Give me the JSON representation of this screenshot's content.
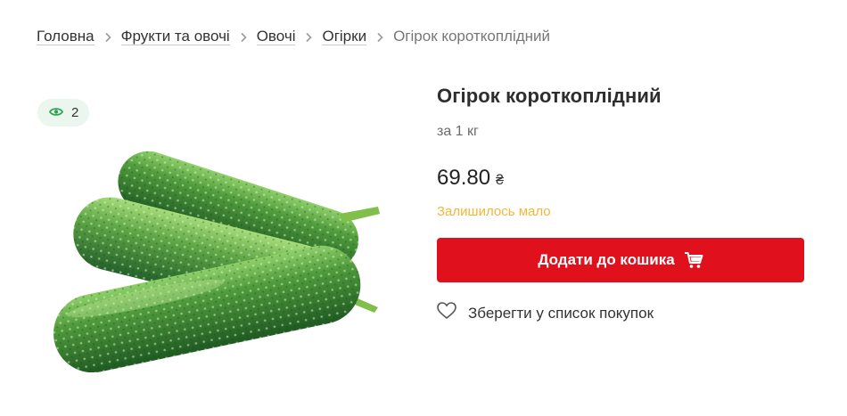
{
  "breadcrumb": {
    "items": [
      {
        "label": "Головна"
      },
      {
        "label": "Фрукти та овочі"
      },
      {
        "label": "Овочі"
      },
      {
        "label": "Огірки"
      }
    ],
    "current": "Огірок короткоплідний"
  },
  "views": {
    "icon": "eye-icon",
    "count": "2"
  },
  "product": {
    "title": "Огірок короткоплідний",
    "unit": "за 1 кг",
    "price": "69.80",
    "currency": "₴",
    "stock_status": "Залишилось мало",
    "image_alt": "cucumber-photo"
  },
  "actions": {
    "add_to_cart_label": "Додати до кошика",
    "cart_icon": "cart-icon",
    "save_label": "Зберегти у список покупок",
    "save_icon": "heart-icon"
  },
  "colors": {
    "accent": "#e0111d",
    "stock_warning": "#f2b63c",
    "views_badge_bg": "#eaf6ee",
    "eye_icon": "#2fa34f"
  }
}
